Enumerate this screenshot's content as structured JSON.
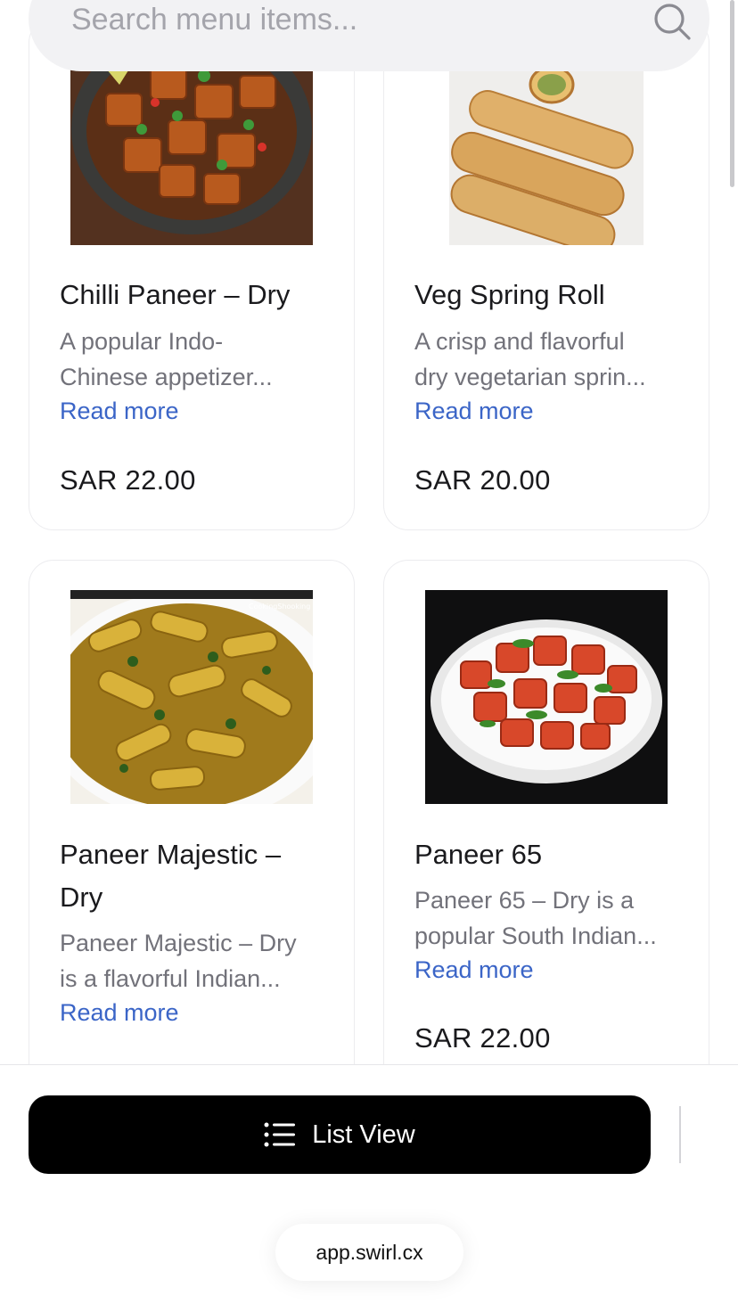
{
  "search": {
    "placeholder": "Search menu items..."
  },
  "items": [
    {
      "title": "Chilli Paneer – Dry",
      "description": "A popular Indo-\nChinese appetizer...",
      "read_more": "Read more",
      "price": "SAR 22.00"
    },
    {
      "title": "Veg Spring Roll",
      "description": "A crisp and flavorful\ndry vegetarian sprin...",
      "read_more": "Read more",
      "price": "SAR 20.00"
    },
    {
      "title": "Paneer Majestic –\nDry",
      "description": "Paneer Majestic – Dry\nis a flavorful Indian...",
      "read_more": "Read more",
      "price": ""
    },
    {
      "title": "Paneer 65",
      "description": "Paneer 65 – Dry is a\npopular South Indian...",
      "read_more": "Read more",
      "price": "SAR 22.00"
    }
  ],
  "image_watermark": "CookingShooking",
  "bottom": {
    "list_view_label": "List View",
    "url": "app.swirl.cx"
  },
  "colors": {
    "link": "#3b65c7",
    "button_bg": "#000000",
    "search_bg": "#f2f2f4"
  }
}
